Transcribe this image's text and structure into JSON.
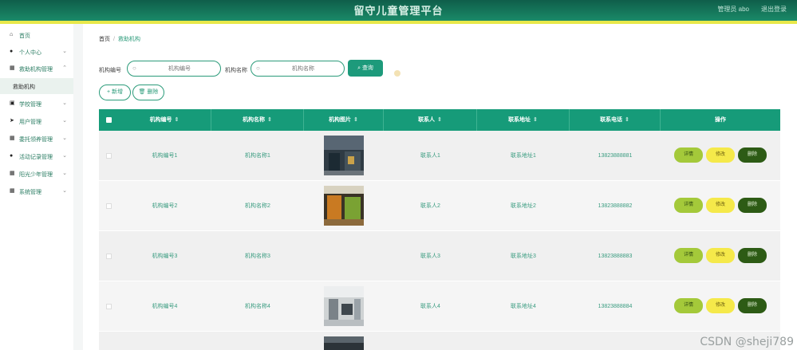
{
  "header": {
    "title": "留守儿童管理平台",
    "user_text": "管理员 abo",
    "logout_label": "退出登录",
    "colors": {
      "bar": "#1a8a68",
      "stripe": "#e8e84a"
    }
  },
  "sidebar": {
    "items": [
      {
        "label": "首页",
        "icon": "home-icon"
      },
      {
        "label": "个人中心",
        "icon": "user-icon"
      },
      {
        "label": "救助机构管理",
        "icon": "grid-icon"
      },
      {
        "label": "救助机构",
        "icon": ""
      },
      {
        "label": "学校管理",
        "icon": "book-icon"
      },
      {
        "label": "用户管理",
        "icon": "send-icon"
      },
      {
        "label": "委托领养管理",
        "icon": "grid-icon"
      },
      {
        "label": "活动记录管理",
        "icon": "person-icon"
      },
      {
        "label": "阳光少年管理",
        "icon": "grid-icon"
      },
      {
        "label": "系统管理",
        "icon": "grid-icon"
      }
    ]
  },
  "breadcrumb": {
    "home": "首页",
    "separator": "/",
    "current": "救助机构"
  },
  "search": {
    "field1_label": "机构编号",
    "field1_placeholder": "机构编号",
    "field2_label": "机构名称",
    "field2_placeholder": "机构名称",
    "query_label": "查询"
  },
  "actions": {
    "add_label": "+ 新增",
    "delete_label": "删除"
  },
  "table": {
    "headers": [
      "机构编号",
      "机构名称",
      "机构图片",
      "联系人",
      "联系地址",
      "联系电话",
      "操作"
    ],
    "rows": [
      {
        "code": "机构编号1",
        "name": "机构名称1",
        "image": "office-photo-dark",
        "contact": "联系人1",
        "address": "联系地址1",
        "phone": "13823888881"
      },
      {
        "code": "机构编号2",
        "name": "机构名称2",
        "image": "office-photo-orange",
        "contact": "联系人2",
        "address": "联系地址2",
        "phone": "13823888882"
      },
      {
        "code": "机构编号3",
        "name": "机构名称3",
        "image": "",
        "contact": "联系人3",
        "address": "联系地址3",
        "phone": "13823888883"
      },
      {
        "code": "机构编号4",
        "name": "机构名称4",
        "image": "office-photo-light",
        "contact": "联系人4",
        "address": "联系地址4",
        "phone": "13823888884"
      }
    ],
    "op_labels": {
      "detail": "详情",
      "edit": "修改",
      "del": "删除"
    },
    "header_color": "#169b79"
  },
  "watermark": "CSDN @sheji789"
}
